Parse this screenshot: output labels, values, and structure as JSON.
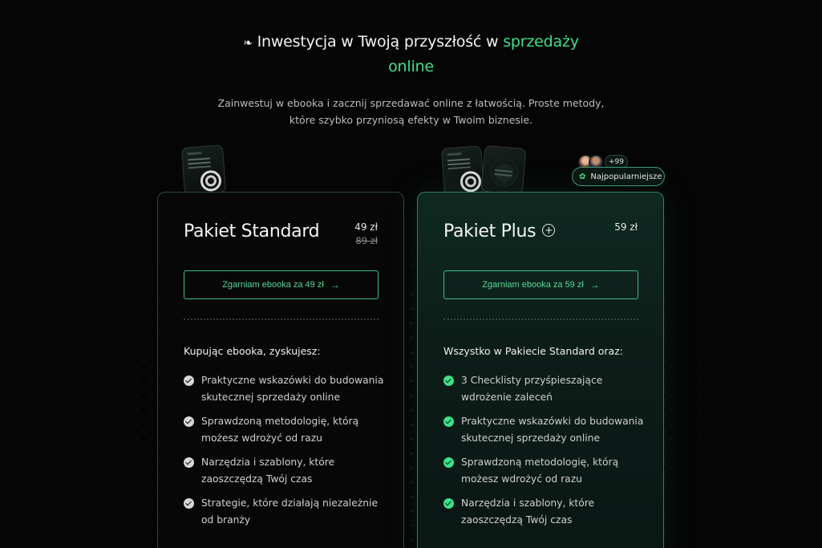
{
  "header": {
    "emoji": "❧",
    "headline_before": "Inwestycja w Twoją przyszłość w",
    "headline_accent_1": "sprzedaży",
    "headline_accent_2": "online",
    "subtitle_line1": "Zainwestuj w ebooka i zacznij sprzedawać online z łatwością. Proste metody,",
    "subtitle_line2": "które szybko przyniosą efekty w Twoim biznesie."
  },
  "popular": {
    "count_badge": "+99",
    "label": "Najpopularniejsze",
    "icon": "award-icon"
  },
  "plans": [
    {
      "title": "Pakiet Standard",
      "price": "49 zł",
      "old_price": "89 zł",
      "cta": "Zgarniam ebooka za 49 zł",
      "cta_arrow": "→",
      "list_heading": "Kupując ebooka, zyskujesz:",
      "features": [
        "Praktyczne wskazówki do budowania skutecznej sprzedaży online",
        "Sprawdzoną metodologię, którą możesz wdrożyć od razu",
        "Narzędzia i szablony, które zaoszczędzą Twój czas",
        "Strategie, które działają niezależnie od branży"
      ]
    },
    {
      "title": "Pakiet Plus",
      "title_icon": "⊕",
      "price": "59 zł",
      "cta": "Zgarniam ebooka za 59 zł",
      "cta_arrow": "→",
      "list_heading": "Wszystko w Pakiecie Standard oraz:",
      "features": [
        "3 Checklisty przyśpieszające wdrożenie zaleceń",
        "Praktyczne wskazówki do budowania skutecznej sprzedaży online",
        "Sprawdzoną metodologię, którą możesz wdrożyć od razu",
        "Narzędzia i szablony, które zaoszczędzą Twój czas"
      ]
    }
  ],
  "colors": {
    "accent": "#3ee08b",
    "background": "#050505",
    "plus_card": "#0c1d18"
  }
}
